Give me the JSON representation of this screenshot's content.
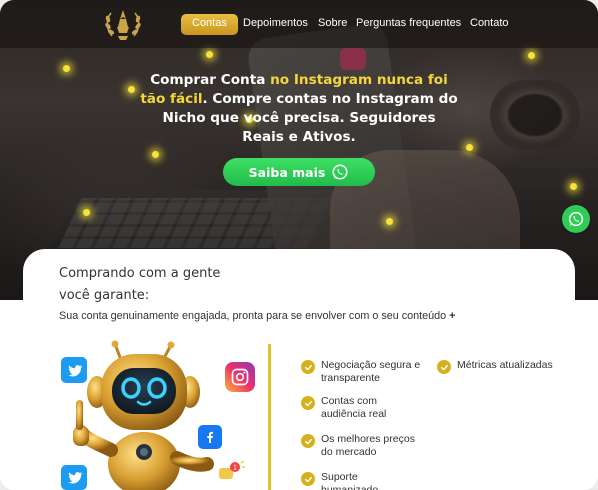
{
  "nav": {
    "items": [
      {
        "label": "Contas",
        "active": true
      },
      {
        "label": "Depoimentos",
        "active": false
      },
      {
        "label": "Sobre",
        "active": false
      },
      {
        "label": "Perguntas frequentes",
        "active": false
      },
      {
        "label": "Contato",
        "active": false
      }
    ]
  },
  "hero": {
    "headline_part1": "Comprar Conta ",
    "headline_highlight": "no Instagram nunca foi tão fácil",
    "headline_part2": ". Compre contas no Instagram do Nicho que você precisa. Seguidores Reais e Ativos.",
    "cta_label": "Saiba mais",
    "cta_icon": "whatsapp-icon"
  },
  "floating": {
    "icon": "whatsapp-icon"
  },
  "benefits": {
    "title_line1": "Comprando com a gente",
    "title_line2": "você garante:",
    "subtitle": "Sua conta genuinamente engajada, pronta para se envolver com o seu conteúdo",
    "subtitle_suffix": "+",
    "features_col1": [
      "Negociação segura e transparente",
      "Contas com audiência real",
      "Os melhores preços do mercado",
      "Suporte humanizado"
    ],
    "features_col2": [
      "Métricas atualizadas"
    ]
  },
  "colors": {
    "accent_gold": "#d6b11f",
    "cta_green": "#2fcd55",
    "highlight_yellow": "#f5d63a"
  }
}
